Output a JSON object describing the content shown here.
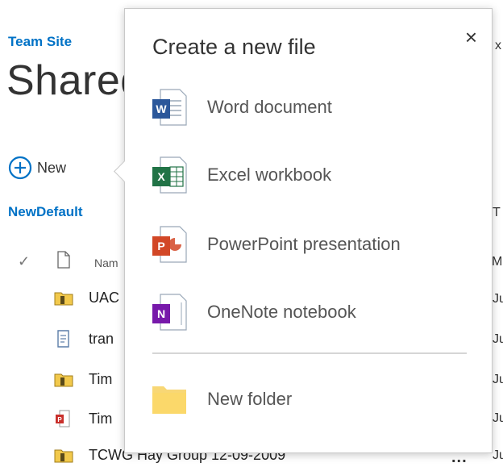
{
  "site": {
    "name": "Team Site"
  },
  "page": {
    "title": "Shared"
  },
  "toolbar": {
    "new_label": "New"
  },
  "view": {
    "name": "NewDefault"
  },
  "list": {
    "header": {
      "name_col": "Nam"
    },
    "rows": [
      {
        "name": "UAC",
        "icon": "folder-icon"
      },
      {
        "name": "tran",
        "icon": "text-doc-icon"
      },
      {
        "name": "Tim",
        "icon": "folder-icon"
      },
      {
        "name": "Tim",
        "icon": "pdf-icon"
      },
      {
        "name": "TCWG Hay Group 12-09-2009",
        "icon": "folder-icon"
      }
    ],
    "right_col_values": [
      "Ju",
      "Ju",
      "Ju",
      "Ju",
      "Ju"
    ],
    "right_header": "M",
    "right_x": "x",
    "right_t": "T"
  },
  "flyout": {
    "title": "Create a new file",
    "close": "×",
    "items": [
      {
        "label": "Word document",
        "icon": "word-icon",
        "color": "#2b579a",
        "letter": "W"
      },
      {
        "label": "Excel workbook",
        "icon": "excel-icon",
        "color": "#217346",
        "letter": "X"
      },
      {
        "label": "PowerPoint presentation",
        "icon": "powerpoint-icon",
        "color": "#d24726",
        "letter": "P"
      },
      {
        "label": "OneNote notebook",
        "icon": "onenote-icon",
        "color": "#7719aa",
        "letter": "N"
      }
    ],
    "folder": {
      "label": "New folder",
      "icon": "folder-icon",
      "color": "#f8d775"
    }
  },
  "colors": {
    "accent": "#0072c6"
  }
}
